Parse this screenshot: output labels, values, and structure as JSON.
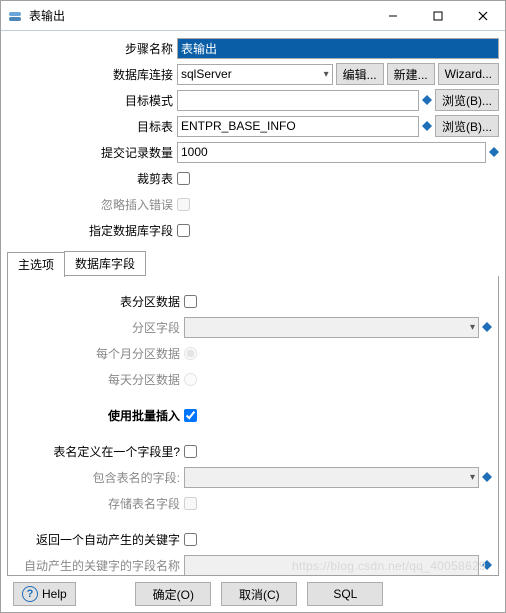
{
  "window": {
    "title": "表输出"
  },
  "titlebar_buttons": {
    "minimize": "—",
    "maximize": "☐",
    "close": "✕"
  },
  "labels": {
    "step_name": "步骤名称",
    "db_conn": "数据库连接",
    "target_schema": "目标模式",
    "target_table": "目标表",
    "commit_size": "提交记录数量",
    "truncate": "裁剪表",
    "ignore_insert_err": "忽略插入错误",
    "specify_db_fields": "指定数据库字段"
  },
  "values": {
    "step_name": "表输出",
    "db_conn": "sqlServer",
    "target_schema": "",
    "target_table": "ENTPR_BASE_INFO",
    "commit_size": "1000"
  },
  "checks": {
    "truncate": false,
    "ignore_insert_err": false,
    "specify_db_fields": false
  },
  "conn_buttons": {
    "edit": "编辑...",
    "new": "新建...",
    "wizard": "Wizard..."
  },
  "browse_buttons": {
    "schema": "浏览(B)...",
    "table": "浏览(B)..."
  },
  "tabs": {
    "main": "主选项",
    "db_fields": "数据库字段"
  },
  "tabpanel": {
    "partition_data": "表分区数据",
    "partition_field": "分区字段",
    "partition_monthly": "每个月分区数据",
    "partition_daily": "每天分区数据",
    "use_batch": "使用批量插入",
    "tablename_in_field": "表名定义在一个字段里?",
    "tablename_field": "包含表名的字段:",
    "store_tablename": "存储表名字段",
    "return_gen_keys": "返回一个自动产生的关键字",
    "gen_key_field": "自动产生的关键字的字段名称",
    "partition_field_value": "",
    "tablename_field_value": "",
    "gen_key_field_value": ""
  },
  "tabchecks": {
    "partition_data": false,
    "use_batch": true,
    "tablename_in_field": false,
    "store_tablename": false,
    "return_gen_keys": false
  },
  "footer": {
    "help": "Help",
    "ok": "确定(O)",
    "cancel": "取消(C)",
    "sql": "SQL"
  },
  "watermark": "https://blog.csdn.net/qq_40058629"
}
